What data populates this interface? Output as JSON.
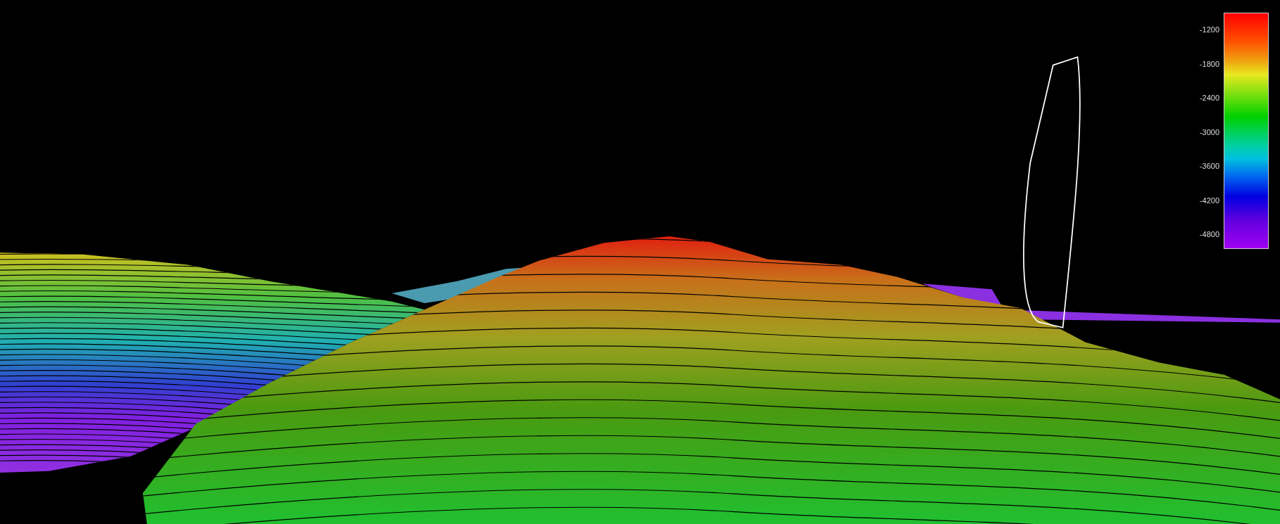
{
  "legend": {
    "ticks": [
      "-1200",
      "-1800",
      "-2400",
      "-3000",
      "-3600",
      "-4200",
      "-4800"
    ]
  }
}
